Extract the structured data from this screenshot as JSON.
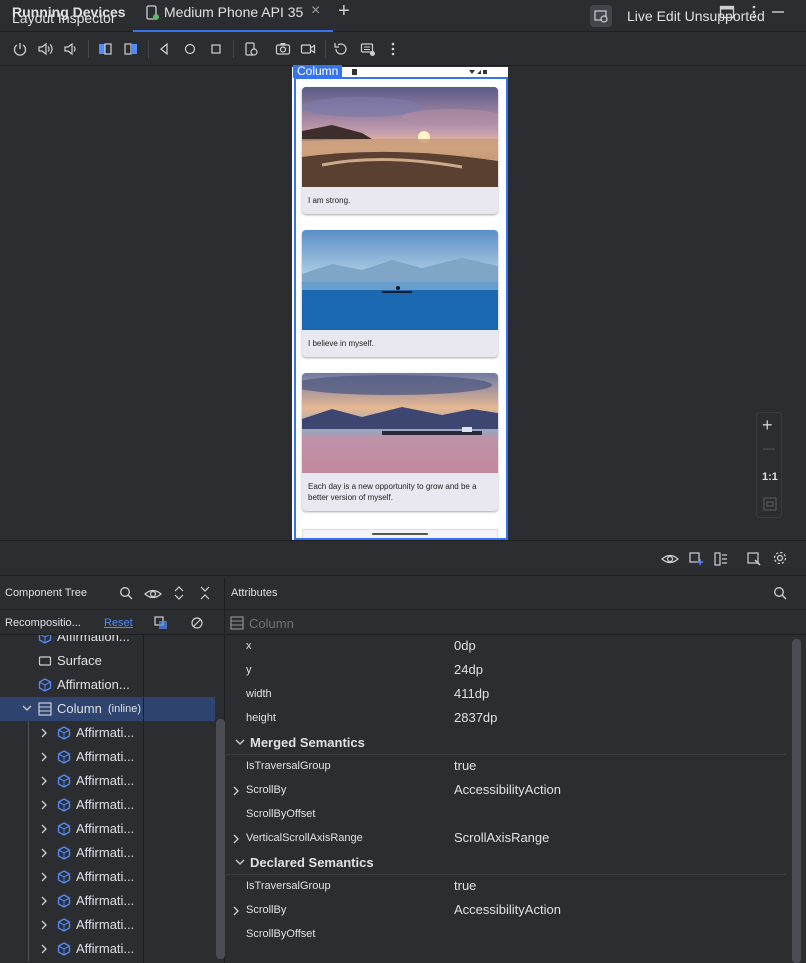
{
  "tabbar": {
    "panel_title": "Running Devices",
    "device_tab": "Medium Phone API 35",
    "close": "×",
    "add": "+"
  },
  "toolbar": {
    "icons": [
      "power-icon",
      "volume-up-icon",
      "volume-down-icon",
      "rotate-left-icon",
      "rotate-right-icon",
      "back-icon",
      "home-icon",
      "overview-icon",
      "device-settings-icon",
      "screenshot-icon",
      "screen-record-icon",
      "reset-icon",
      "keyboard-icon",
      "more-icon"
    ],
    "live_edit_label": "Live Edit Unsupported"
  },
  "device": {
    "column_tag": "Column",
    "cards": [
      {
        "caption": "I am strong."
      },
      {
        "caption": "I believe in myself."
      },
      {
        "caption": "Each day is a new opportunity to grow and be a better version of myself."
      }
    ],
    "zoom": {
      "plus": "+",
      "minus": "—",
      "one_to_one": "1:1"
    }
  },
  "layout_inspector": {
    "title": "Layout Inspector",
    "component_tree": {
      "title": "Component Tree",
      "recomposition_label": "Recompositio...",
      "reset_label": "Reset",
      "rows": [
        {
          "label": "Affirmation...",
          "icon": "compose-icon",
          "indent": 1
        },
        {
          "label": "Surface",
          "icon": "surface-icon",
          "indent": 1
        },
        {
          "label": "Affirmation...",
          "icon": "compose-icon",
          "indent": 1
        },
        {
          "label": "Column",
          "suffix": "(inline)",
          "icon": "column-icon",
          "indent": 1,
          "selected": true,
          "expanded": true
        },
        {
          "label": "Affirmati...",
          "icon": "compose-icon",
          "indent": 2
        },
        {
          "label": "Affirmati...",
          "icon": "compose-icon",
          "indent": 2
        },
        {
          "label": "Affirmati...",
          "icon": "compose-icon",
          "indent": 2
        },
        {
          "label": "Affirmati...",
          "icon": "compose-icon",
          "indent": 2
        },
        {
          "label": "Affirmati...",
          "icon": "compose-icon",
          "indent": 2
        },
        {
          "label": "Affirmati...",
          "icon": "compose-icon",
          "indent": 2
        },
        {
          "label": "Affirmati...",
          "icon": "compose-icon",
          "indent": 2
        },
        {
          "label": "Affirmati...",
          "icon": "compose-icon",
          "indent": 2
        },
        {
          "label": "Affirmati...",
          "icon": "compose-icon",
          "indent": 2
        },
        {
          "label": "Affirmati...",
          "icon": "compose-icon",
          "indent": 2
        }
      ]
    },
    "attributes": {
      "title": "Attributes",
      "node_label": "Column",
      "basic": [
        {
          "key": "x",
          "value": "0dp"
        },
        {
          "key": "y",
          "value": "24dp"
        },
        {
          "key": "width",
          "value": "411dp"
        },
        {
          "key": "height",
          "value": "2837dp"
        }
      ],
      "merged_title": "Merged Semantics",
      "merged": [
        {
          "key": "IsTraversalGroup",
          "value": "true",
          "expandable": false
        },
        {
          "key": "ScrollBy",
          "value": "AccessibilityAction",
          "expandable": true
        },
        {
          "key": "ScrollByOffset",
          "value": "",
          "expandable": false
        },
        {
          "key": "VerticalScrollAxisRange",
          "value": "ScrollAxisRange",
          "expandable": true
        }
      ],
      "declared_title": "Declared Semantics",
      "declared": [
        {
          "key": "IsTraversalGroup",
          "value": "true",
          "expandable": false
        },
        {
          "key": "ScrollBy",
          "value": "AccessibilityAction",
          "expandable": true
        },
        {
          "key": "ScrollByOffset",
          "value": "",
          "expandable": false
        }
      ]
    }
  },
  "colors": {
    "accent": "#3574f0",
    "selection": "#2e436e",
    "background": "#2b2d30"
  }
}
